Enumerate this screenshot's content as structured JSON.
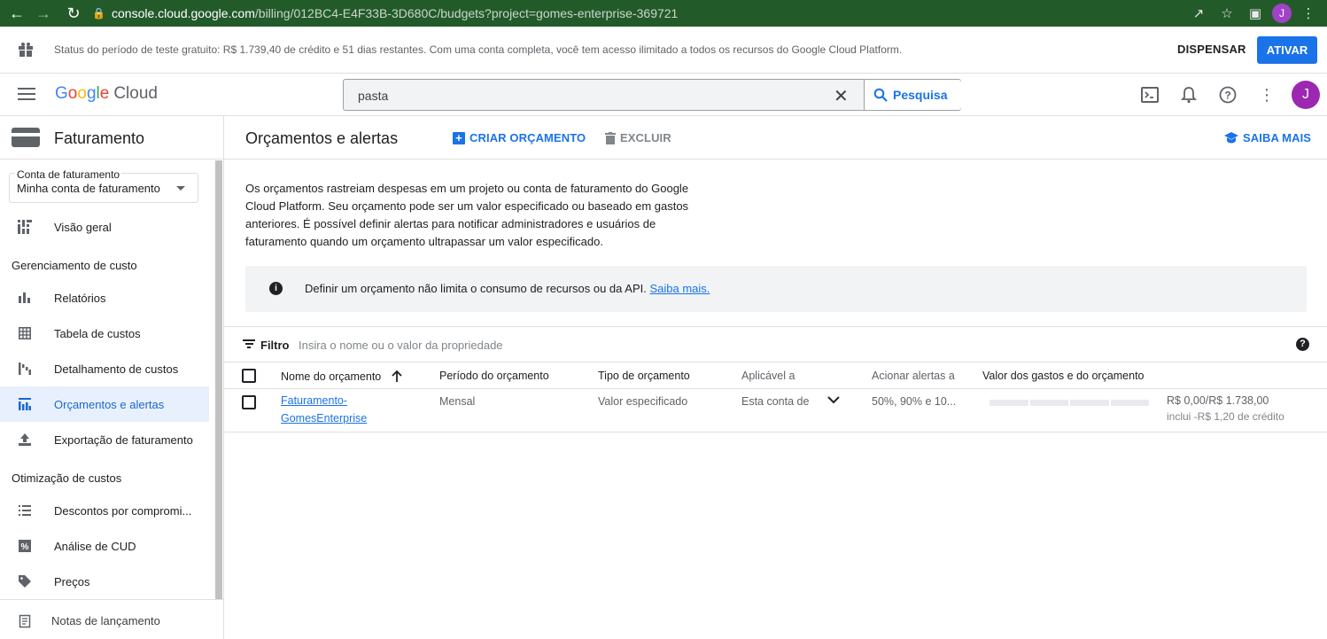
{
  "browser": {
    "url_host": "console.cloud.google.com",
    "url_rest": "/billing/012BC4-E4F33B-3D680C/budgets?project=gomes-enterprise-369721",
    "profile_initial": "J"
  },
  "trial_banner": {
    "message": "Status do período de teste gratuito: R$ 1.739,40 de crédito e 51 dias restantes. Com uma conta completa, você tem acesso ilimitado a todos os recursos do Google Cloud Platform.",
    "dismiss_label": "DISPENSAR",
    "activate_label": "ATIVAR"
  },
  "header": {
    "logo": {
      "g1": "G",
      "g2": "o",
      "g3": "o",
      "g4": "g",
      "g5": "l",
      "g6": "e",
      "cloud": "Cloud"
    },
    "search_value": "pasta",
    "search_button": "Pesquisa",
    "avatar_initial": "J"
  },
  "sidebar": {
    "title": "Faturamento",
    "account_label": "Conta de faturamento",
    "account_value": "Minha conta de faturamento",
    "overview": "Visão geral",
    "section_cost_mgmt": "Gerenciamento de custo",
    "items_cost": [
      "Relatórios",
      "Tabela de custos",
      "Detalhamento de custos",
      "Orçamentos e alertas",
      "Exportação de faturamento"
    ],
    "section_cost_opt": "Otimização de custos",
    "items_opt": [
      "Descontos por compromi...",
      "Análise de CUD",
      "Preços"
    ],
    "footer": "Notas de lançamento"
  },
  "main": {
    "title": "Orçamentos e alertas",
    "create_label": "CRIAR ORÇAMENTO",
    "delete_label": "EXCLUIR",
    "learn_label": "SAIBA MAIS",
    "description": "Os orçamentos rastreiam despesas em um projeto ou conta de faturamento do Google Cloud Platform. Seu orçamento pode ser um valor especificado ou baseado em gastos anteriores. É possível definir alertas para notificar administradores e usuários de faturamento quando um orçamento ultrapassar um valor especificado.",
    "info_text": "Definir um orçamento não limita o consumo de recursos ou da API.",
    "info_link": "Saiba mais.",
    "filter_label": "Filtro",
    "filter_placeholder": "Insira o nome ou o valor da propriedade",
    "columns": [
      "Nome do orçamento",
      "Período do orçamento",
      "Tipo de orçamento",
      "Aplicável a",
      "Acionar alertas a",
      "Valor dos gastos e do orçamento"
    ],
    "rows": [
      {
        "name_line1": "Faturamento-",
        "name_line2": "GomesEnterprise",
        "period": "Mensal",
        "type": "Valor especificado",
        "applies_to": "Esta conta de",
        "alerts": "50%, 90% e 10...",
        "amount": "R$ 0,00/R$ 1.738,00",
        "credit": "inclui -R$ 1,20 de crédito",
        "spend_fraction": 0
      }
    ]
  }
}
